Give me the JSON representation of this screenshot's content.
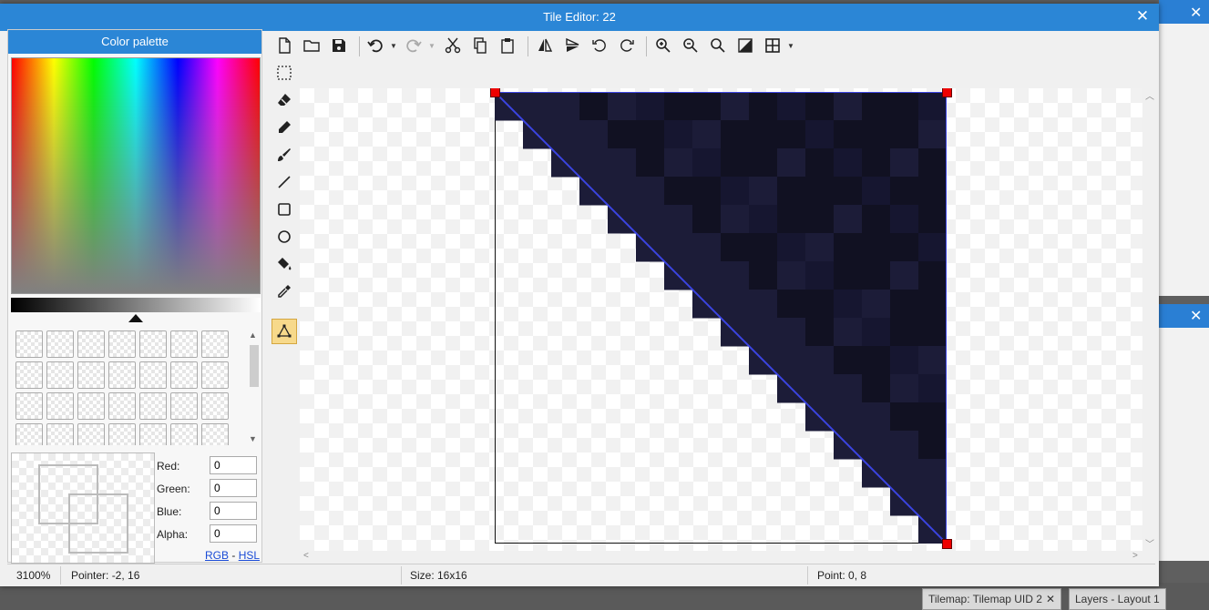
{
  "dialog": {
    "title": "Tile Editor: 22",
    "close_label": "✕"
  },
  "palette": {
    "header": "Color palette",
    "fields": {
      "red_label": "Red:",
      "red_value": "0",
      "green_label": "Green:",
      "green_value": "0",
      "blue_label": "Blue:",
      "blue_value": "0",
      "alpha_label": "Alpha:",
      "alpha_value": "0"
    },
    "mode_rgb": "RGB",
    "mode_sep": "-",
    "mode_hsl": "HSL"
  },
  "toolbar": {
    "icons": [
      "new-file-icon",
      "open-folder-icon",
      "save-icon",
      "undo-icon",
      "redo-icon",
      "cut-icon",
      "copy-icon",
      "paste-icon",
      "flip-horizontal-icon",
      "flip-vertical-icon",
      "rotate-left-icon",
      "rotate-right-icon",
      "zoom-in-icon",
      "zoom-out-icon",
      "zoom-reset-icon",
      "invert-icon",
      "grid-icon"
    ]
  },
  "tools": {
    "icons": [
      "select-rect-icon",
      "eraser-icon",
      "pencil-icon",
      "brush-icon",
      "line-icon",
      "rectangle-icon",
      "ellipse-icon",
      "fill-bucket-icon",
      "eyedropper-icon",
      "collision-polygon-icon"
    ],
    "active": "collision-polygon-icon"
  },
  "tile": {
    "grid_size": 16,
    "colors": {
      "dark1": "#111122",
      "dark2": "#161630",
      "dark3": "#1c1c38",
      "polygon": "#3b44e0",
      "handle": "#e00000"
    }
  },
  "status": {
    "zoom": "3100%",
    "pointer": "Pointer: -2, 16",
    "size": "Size: 16x16",
    "point": "Point: 0, 8"
  },
  "background": {
    "tab1": "Tilemap: Tilemap UID 2",
    "tab2": "Layers - Layout 1",
    "tab_close": "✕"
  },
  "colors": {
    "accent": "#2b86d6",
    "active_tool": "#f7d98b"
  }
}
